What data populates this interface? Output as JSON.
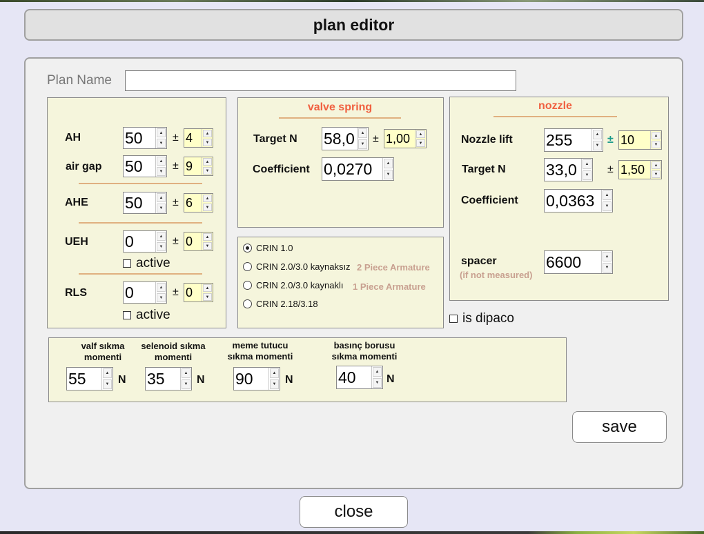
{
  "window": {
    "title": "plan editor"
  },
  "plan": {
    "label": "Plan Name",
    "value": ""
  },
  "left": {
    "ah": {
      "label": "AH",
      "value": "50",
      "tol": "4"
    },
    "airgap": {
      "label": "air gap",
      "value": "50",
      "tol": "9"
    },
    "ahe": {
      "label": "AHE",
      "value": "50",
      "tol": "6"
    },
    "ueh": {
      "label": "UEH",
      "value": "0",
      "tol": "0",
      "active_label": "active",
      "active": false
    },
    "rls": {
      "label": "RLS",
      "value": "0",
      "tol": "0",
      "active_label": "active",
      "active": false
    },
    "pm": "±"
  },
  "valve": {
    "title": "valve spring",
    "target_label": "Target N",
    "target": "58,0",
    "target_tol": "1,00",
    "coef_label": "Coefficient",
    "coef": "0,0270"
  },
  "crin": {
    "options": [
      {
        "label": "CRIN 1.0",
        "selected": true,
        "note": ""
      },
      {
        "label": "CRIN 2.0/3.0 kaynaksız",
        "selected": false,
        "note": "2 Piece Armature"
      },
      {
        "label": "CRIN 2.0/3.0 kaynaklı",
        "selected": false,
        "note": "1 Piece Armature"
      },
      {
        "label": "CRIN 2.18/3.18",
        "selected": false,
        "note": ""
      }
    ]
  },
  "nozzle": {
    "title": "nozzle",
    "lift_label": "Nozzle lift",
    "lift": "255",
    "lift_tol": "10",
    "target_label": "Target N",
    "target": "33,0",
    "target_tol": "1,50",
    "coef_label": "Coefficient",
    "coef": "0,0363",
    "spacer_label": "spacer",
    "spacer_note": "(if not measured)",
    "spacer": "6600"
  },
  "dipaco": {
    "label": "is dipaco",
    "checked": false
  },
  "torque": {
    "unit": "N",
    "items": [
      {
        "line1": "valf sıkma",
        "line2": "momenti",
        "value": "55"
      },
      {
        "line1": "selenoid sıkma",
        "line2": "momenti",
        "value": "35"
      },
      {
        "line1": "meme tutucu",
        "line2": "sıkma momenti",
        "value": "90"
      },
      {
        "line1": "basınç borusu",
        "line2": "sıkma momenti",
        "value": "40"
      }
    ]
  },
  "buttons": {
    "save": "save",
    "close": "close"
  },
  "icons": {
    "spin_up": "arrow-up-icon",
    "spin_down": "arrow-down-icon",
    "up_glyph": "▲",
    "down_glyph": "▼"
  }
}
